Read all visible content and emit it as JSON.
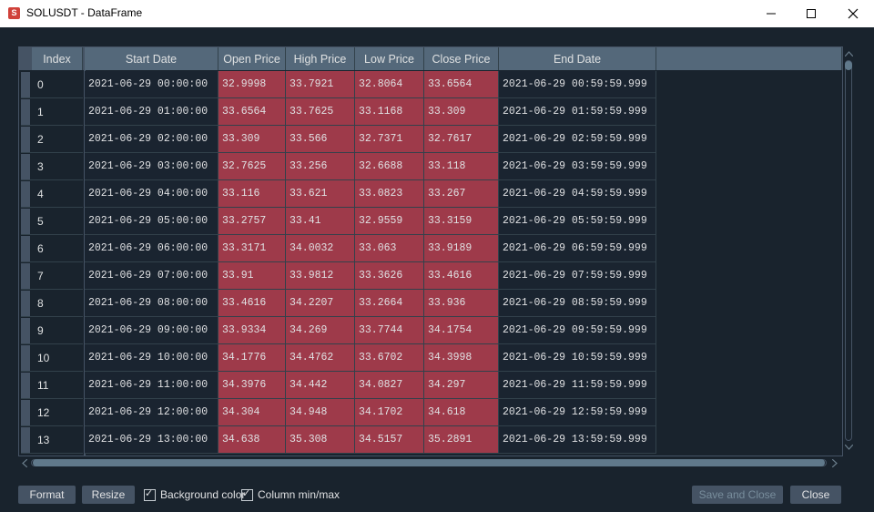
{
  "window": {
    "title": "SOLUSDT - DataFrame",
    "app_icon": "spyder-icon",
    "controls": {
      "minimize": "minimize-icon",
      "maximize": "maximize-icon",
      "close": "close-icon"
    }
  },
  "table": {
    "index_header": "Index",
    "columns": [
      "Start Date",
      "Open Price",
      "High Price",
      "Low Price",
      "Close Price",
      "End Date"
    ],
    "highlight_color": "#9e3a4a",
    "rows": [
      {
        "index": "0",
        "cells": [
          "2021-06-29 00:00:00",
          "32.9998",
          "33.7921",
          "32.8064",
          "33.6564",
          "2021-06-29 00:59:59.999"
        ]
      },
      {
        "index": "1",
        "cells": [
          "2021-06-29 01:00:00",
          "33.6564",
          "33.7625",
          "33.1168",
          "33.309",
          "2021-06-29 01:59:59.999"
        ]
      },
      {
        "index": "2",
        "cells": [
          "2021-06-29 02:00:00",
          "33.309",
          "33.566",
          "32.7371",
          "32.7617",
          "2021-06-29 02:59:59.999"
        ]
      },
      {
        "index": "3",
        "cells": [
          "2021-06-29 03:00:00",
          "32.7625",
          "33.256",
          "32.6688",
          "33.118",
          "2021-06-29 03:59:59.999"
        ]
      },
      {
        "index": "4",
        "cells": [
          "2021-06-29 04:00:00",
          "33.116",
          "33.621",
          "33.0823",
          "33.267",
          "2021-06-29 04:59:59.999"
        ]
      },
      {
        "index": "5",
        "cells": [
          "2021-06-29 05:00:00",
          "33.2757",
          "33.41",
          "32.9559",
          "33.3159",
          "2021-06-29 05:59:59.999"
        ]
      },
      {
        "index": "6",
        "cells": [
          "2021-06-29 06:00:00",
          "33.3171",
          "34.0032",
          "33.063",
          "33.9189",
          "2021-06-29 06:59:59.999"
        ]
      },
      {
        "index": "7",
        "cells": [
          "2021-06-29 07:00:00",
          "33.91",
          "33.9812",
          "33.3626",
          "33.4616",
          "2021-06-29 07:59:59.999"
        ]
      },
      {
        "index": "8",
        "cells": [
          "2021-06-29 08:00:00",
          "33.4616",
          "34.2207",
          "33.2664",
          "33.936",
          "2021-06-29 08:59:59.999"
        ]
      },
      {
        "index": "9",
        "cells": [
          "2021-06-29 09:00:00",
          "33.9334",
          "34.269",
          "33.7744",
          "34.1754",
          "2021-06-29 09:59:59.999"
        ]
      },
      {
        "index": "10",
        "cells": [
          "2021-06-29 10:00:00",
          "34.1776",
          "34.4762",
          "33.6702",
          "34.3998",
          "2021-06-29 10:59:59.999"
        ]
      },
      {
        "index": "11",
        "cells": [
          "2021-06-29 11:00:00",
          "34.3976",
          "34.442",
          "34.0827",
          "34.297",
          "2021-06-29 11:59:59.999"
        ]
      },
      {
        "index": "12",
        "cells": [
          "2021-06-29 12:00:00",
          "34.304",
          "34.948",
          "34.1702",
          "34.618",
          "2021-06-29 12:59:59.999"
        ]
      },
      {
        "index": "13",
        "cells": [
          "2021-06-29 13:00:00",
          "34.638",
          "35.308",
          "34.5157",
          "35.2891",
          "2021-06-29 13:59:59.999"
        ]
      }
    ]
  },
  "footer": {
    "format_label": "Format",
    "resize_label": "Resize",
    "background_color_label": "Background color",
    "background_color_checked": true,
    "column_minmax_label": "Column min/max",
    "column_minmax_checked": true,
    "save_close_label": "Save and Close",
    "close_label": "Close"
  }
}
